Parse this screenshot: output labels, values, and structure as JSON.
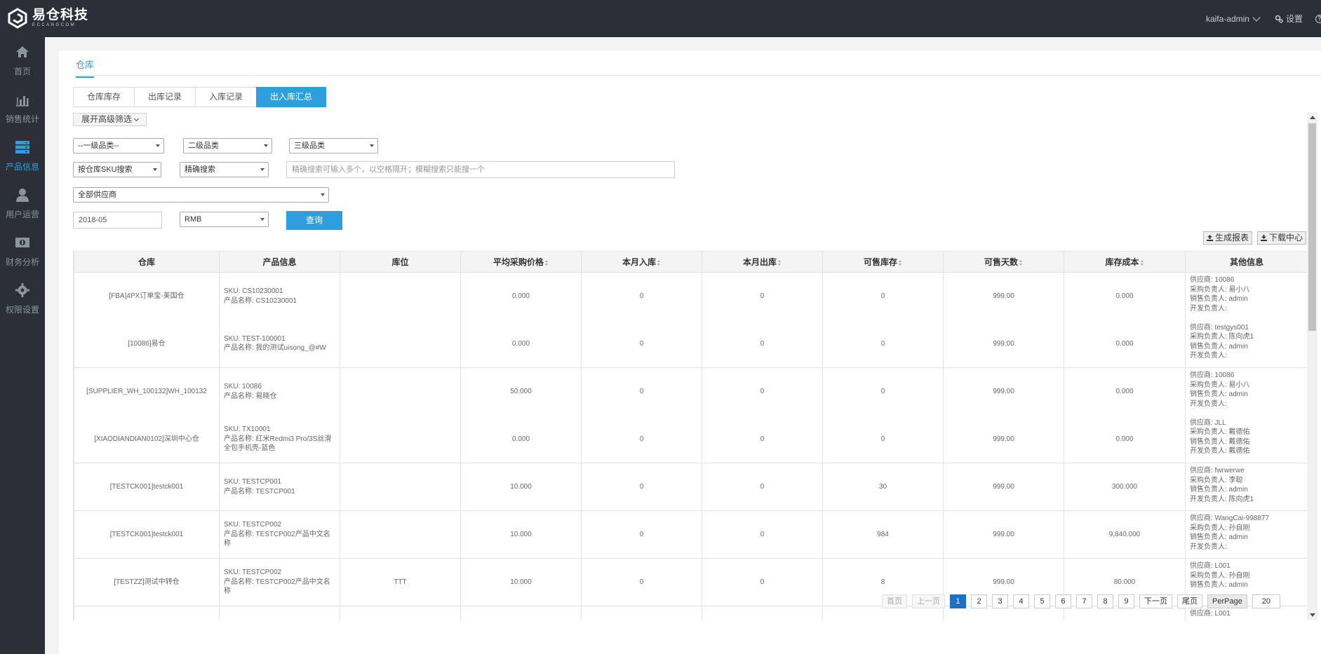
{
  "header": {
    "logo_cn": "易仓科技",
    "logo_en": "ECCANGCOM",
    "user": "kaifa-admin",
    "settings": "设置"
  },
  "nav": [
    {
      "label": "首页",
      "icon": "home-icon"
    },
    {
      "label": "销售统计",
      "icon": "bar-chart-icon"
    },
    {
      "label": "产品信息",
      "icon": "server-icon"
    },
    {
      "label": "用户运营",
      "icon": "user-icon"
    },
    {
      "label": "财务分析",
      "icon": "money-icon"
    },
    {
      "label": "权限设置",
      "icon": "gear-icon"
    }
  ],
  "page_tab": "仓库",
  "subtabs": [
    "仓库库存",
    "出库记录",
    "入库记录",
    "出入库汇总"
  ],
  "filters": {
    "advanced": "展开高级筛选",
    "cat1": "--一级品类--",
    "cat2": "二级品类",
    "cat3": "三级品类",
    "search_by": "按仓库SKU搜索",
    "search_mode": "精确搜索",
    "search_placeholder": "精确搜索可输入多个，以空格隔开；模糊搜索只能搜一个",
    "supplier": "全部供应商",
    "month": "2018-05",
    "currency": "RMB",
    "query": "查询"
  },
  "tools": {
    "report": "生成报表",
    "download": "下载中心"
  },
  "table": {
    "headers": [
      "仓库",
      "产品信息",
      "库位",
      "平均采购价格",
      "本月入库",
      "本月出库",
      "可售库存",
      "可售天数",
      "库存成本",
      "其他信息"
    ],
    "rows": [
      {
        "wh": "[FBA]4PX订单宝-美国仓",
        "sku": "SKU: CS10230001",
        "name": "产品名称: CS10230001",
        "loc": "",
        "price": "0.000",
        "in": "0",
        "out": "0",
        "stock": "0",
        "days": "999.00",
        "cost": "0.000",
        "info": [
          "供应商: 10086",
          "采购负责人: 易小八",
          "销售负责人: admin",
          "开发负责人:"
        ]
      },
      {
        "wh": "[10086]易仓",
        "sku": "SKU: TEST-100001",
        "name": "产品名称: 我的测试uisong_@#W",
        "loc": "",
        "price": "0.000",
        "in": "0",
        "out": "0",
        "stock": "0",
        "days": "999.00",
        "cost": "0.000",
        "info": [
          "供应商: testgys001",
          "采购负责人: 陈向虎1",
          "销售负责人: admin",
          "开发负责人:"
        ]
      },
      {
        "wh": "[SUPPLIER_WH_100132]WH_100132",
        "sku": "SKU: 10086",
        "name": "产品名称: 易晓仓",
        "loc": "",
        "price": "50.000",
        "in": "0",
        "out": "0",
        "stock": "0",
        "days": "999.00",
        "cost": "0.000",
        "info": [
          "供应商: 10086",
          "采购负责人: 易小八",
          "销售负责人: admin",
          "开发负责人:"
        ]
      },
      {
        "wh": "[XIAODIANDIAN0102]深圳中心仓",
        "sku": "SKU: TX10001",
        "name": "产品名称: 红米Redmi3 Pro/3S丝滑全包手机壳-蓝色",
        "loc": "",
        "price": "0.000",
        "in": "0",
        "out": "0",
        "stock": "0",
        "days": "999.00",
        "cost": "0.000",
        "info": [
          "供应商: JLL",
          "采购负责人: 戴德佑",
          "销售负责人: 戴德佑",
          "开发负责人: 戴德佑"
        ]
      },
      {
        "wh": "[TESTCK001]testck001",
        "sku": "SKU: TESTCP001",
        "name": "产品名称: TESTCP001",
        "loc": "",
        "price": "10.000",
        "in": "0",
        "out": "0",
        "stock": "30",
        "days": "999.00",
        "cost": "300.000",
        "info": [
          "供应商: fwrwerwe",
          "采购负责人: 李聪",
          "销售负责人: admin",
          "开发负责人: 陈向虎1"
        ]
      },
      {
        "wh": "[TESTCK001]testck001",
        "sku": "SKU: TESTCP002",
        "name": "产品名称: TESTCP002产品中文名称",
        "loc": "",
        "price": "10.000",
        "in": "0",
        "out": "0",
        "stock": "984",
        "days": "999.00",
        "cost": "9,840.000",
        "info": [
          "供应商: WangCai-998877",
          "采购负责人: 孙自刚",
          "销售负责人: admin",
          "开发负责人:"
        ]
      },
      {
        "wh": "[TESTZZ]测试中转仓",
        "sku": "SKU: TESTCP002",
        "name": "产品名称: TESTCP002产品中文名称",
        "loc": "TTT",
        "price": "10.000",
        "in": "0",
        "out": "0",
        "stock": "8",
        "days": "999.00",
        "cost": "80.000",
        "info": [
          "供应商: L001",
          "采购负责人: 孙自刚",
          "销售负责人: admin",
          ""
        ]
      },
      {
        "wh": "",
        "sku": "",
        "name": "",
        "loc": "",
        "price": "",
        "in": "",
        "out": "",
        "stock": "",
        "days": "",
        "cost": "",
        "info": [
          "供应商: L001",
          "",
          "",
          ""
        ]
      }
    ]
  },
  "pager": {
    "first": "首页",
    "prev": "上一页",
    "pages": [
      "1",
      "2",
      "3",
      "4",
      "5",
      "6",
      "7",
      "8",
      "9"
    ],
    "next": "下一页",
    "last": "尾页",
    "perpage": "PerPage",
    "perpage_value": "20"
  }
}
